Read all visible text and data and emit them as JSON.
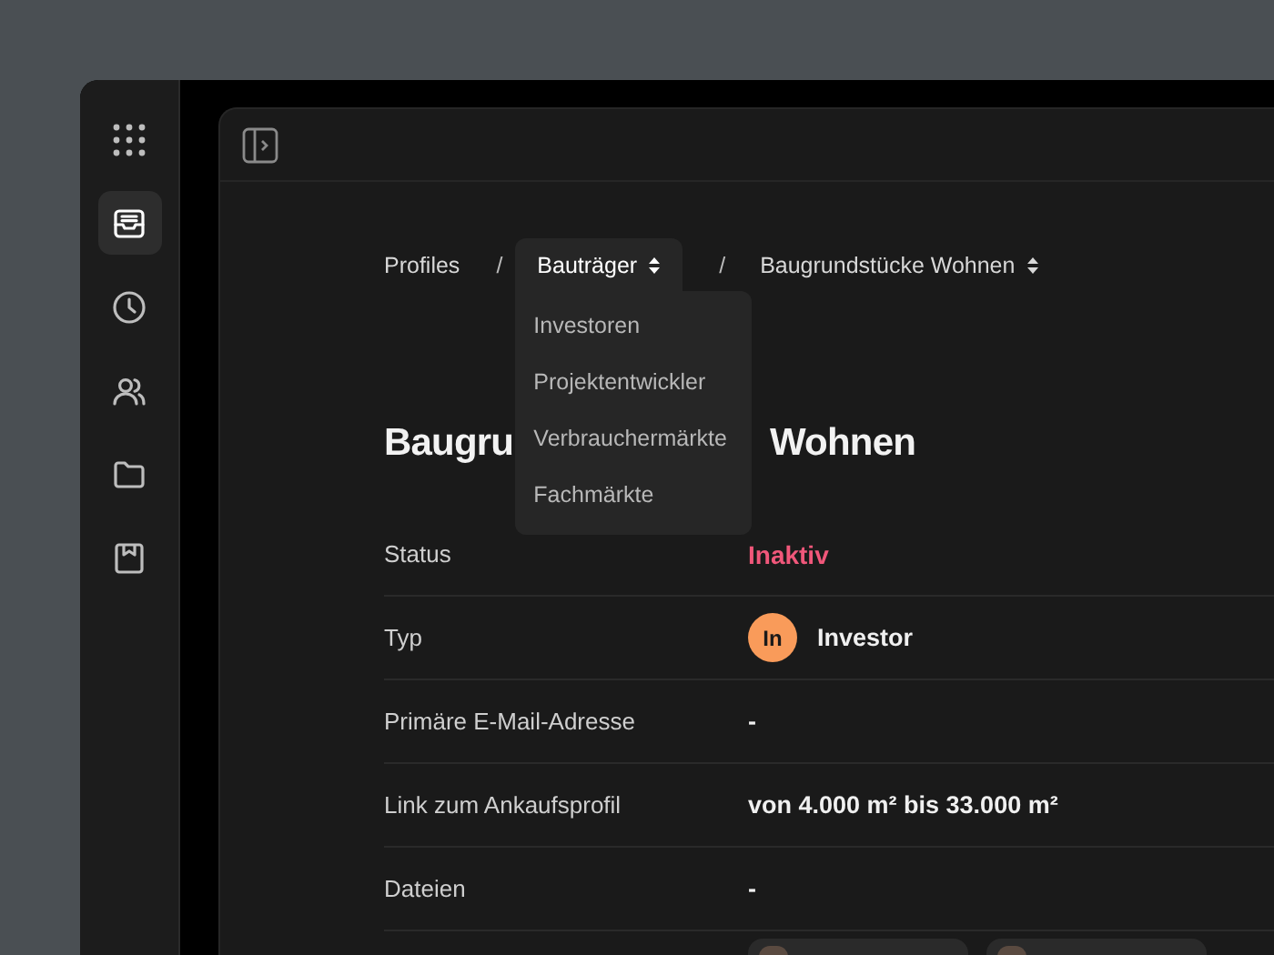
{
  "sidebar": {
    "items": [
      {
        "kind": "apps",
        "selected": false
      },
      {
        "kind": "inbox",
        "selected": true
      },
      {
        "kind": "clock",
        "selected": false
      },
      {
        "kind": "users",
        "selected": false
      },
      {
        "kind": "folder",
        "selected": false
      },
      {
        "kind": "bookmark",
        "selected": false
      }
    ]
  },
  "breadcrumbs": [
    {
      "label": "Profiles",
      "dropdown": false,
      "open": false
    },
    {
      "label": "Bauträger",
      "dropdown": true,
      "open": true
    },
    {
      "label": "Baugrundstücke Wohnen",
      "dropdown": true,
      "open": false
    }
  ],
  "separator": "/",
  "dropdown_menu": [
    "Investoren",
    "Projektentwickler",
    "Verbrauchermärkte",
    "Fachmärkte"
  ],
  "title": {
    "start": "Baugru",
    "end": "Wohnen"
  },
  "fields": [
    {
      "label": "Status",
      "kind": "status",
      "value": "Inaktiv",
      "color": "#f0577a"
    },
    {
      "label": "Typ",
      "kind": "type",
      "badge": "In",
      "value": "Investor",
      "color": "#f99b5a"
    },
    {
      "label": "Primäre E-Mail-Adresse",
      "kind": "text",
      "value": "-"
    },
    {
      "label": "Link zum Ankaufsprofil",
      "kind": "text",
      "value": "von 4.000 m² bis 33.000 m²"
    },
    {
      "label": "Dateien",
      "kind": "text",
      "value": "-"
    },
    {
      "kind": "people"
    }
  ]
}
